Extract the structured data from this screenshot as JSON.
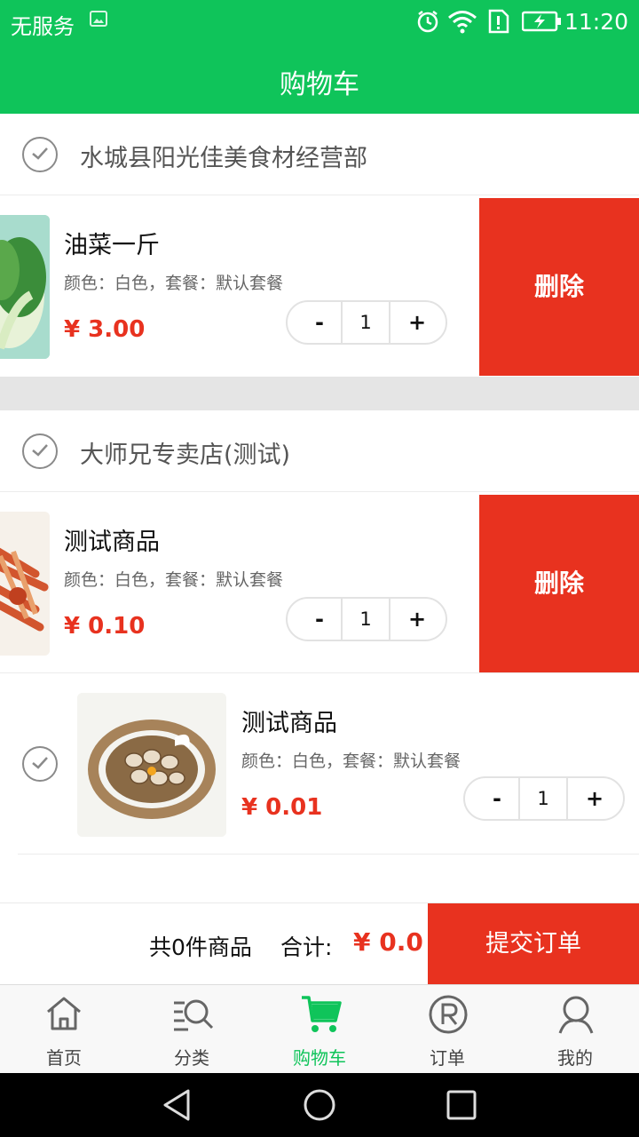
{
  "status_bar": {
    "carrier": "无服务",
    "time": "11:20"
  },
  "header": {
    "title": "购物车"
  },
  "stores": [
    {
      "name": "水城县阳光佳美食材经营部",
      "items": [
        {
          "name": "油菜一斤",
          "spec": "颜色：白色，套餐：默认套餐",
          "price": "¥ 3.00",
          "qty": "1",
          "delete_label": "删除"
        }
      ]
    },
    {
      "name": "大师兄专卖店(测试)",
      "items": [
        {
          "name": "测试商品",
          "spec": "颜色：白色，套餐：默认套餐",
          "price": "¥ 0.10",
          "qty": "1",
          "delete_label": "删除"
        },
        {
          "name": "测试商品",
          "spec": "颜色：白色，套餐：默认套餐",
          "price": "¥ 0.01",
          "qty": "1"
        }
      ]
    }
  ],
  "stepper": {
    "minus": "-",
    "plus": "+"
  },
  "footer": {
    "count_text": "共0件商品",
    "total_label": "合计:",
    "total_value": "¥ 0.0",
    "submit_label": "提交订单"
  },
  "tabs": [
    {
      "label": "首页",
      "icon": "home-icon"
    },
    {
      "label": "分类",
      "icon": "category-search-icon"
    },
    {
      "label": "购物车",
      "icon": "cart-icon",
      "active": true
    },
    {
      "label": "订单",
      "icon": "registered-icon"
    },
    {
      "label": "我的",
      "icon": "user-icon"
    }
  ],
  "colors": {
    "brand_green": "#0fc45a",
    "accent_red": "#e8321f"
  }
}
